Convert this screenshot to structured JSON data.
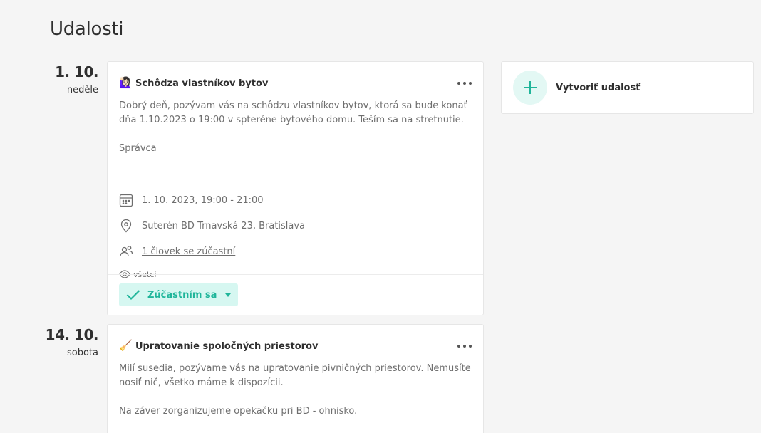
{
  "page": {
    "title": "Udalosti"
  },
  "create": {
    "label": "Vytvoriť udalosť"
  },
  "events": [
    {
      "date": "1. 10.",
      "weekday": "neděle",
      "emoji": "🙋🏻‍♀️",
      "title": "Schôdza vlastníkov bytov",
      "description": "Dobrý deň, pozývam vás na schôdzu vlastníkov bytov, ktorá sa bude konať dňa 1.10.2023 o 19:00 v spteréne bytového domu. Teším sa na stretnutie.\n\nSprávca",
      "datetime": "1. 10. 2023, 19:00 - 21:00",
      "location": "Suterén BD Trnavská 23, Bratislava",
      "attendees": "1 človek se zúčastní",
      "visibility": "všetci",
      "attend_label": "Zúčastním sa"
    },
    {
      "date": "14. 10.",
      "weekday": "sobota",
      "emoji": "🧹",
      "title": "Upratovanie spoločných priestorov",
      "description": "Milí susedia, pozývame vás na upratovanie pivničných priestorov. Nemusíte nosiť nič, všetko máme k dispozícii.\n\nNa záver zorganizujeme opekačku pri BD - ohnisko."
    }
  ],
  "colors": {
    "accent": "#1fb59a",
    "accent_bg": "#d6f7f1"
  }
}
